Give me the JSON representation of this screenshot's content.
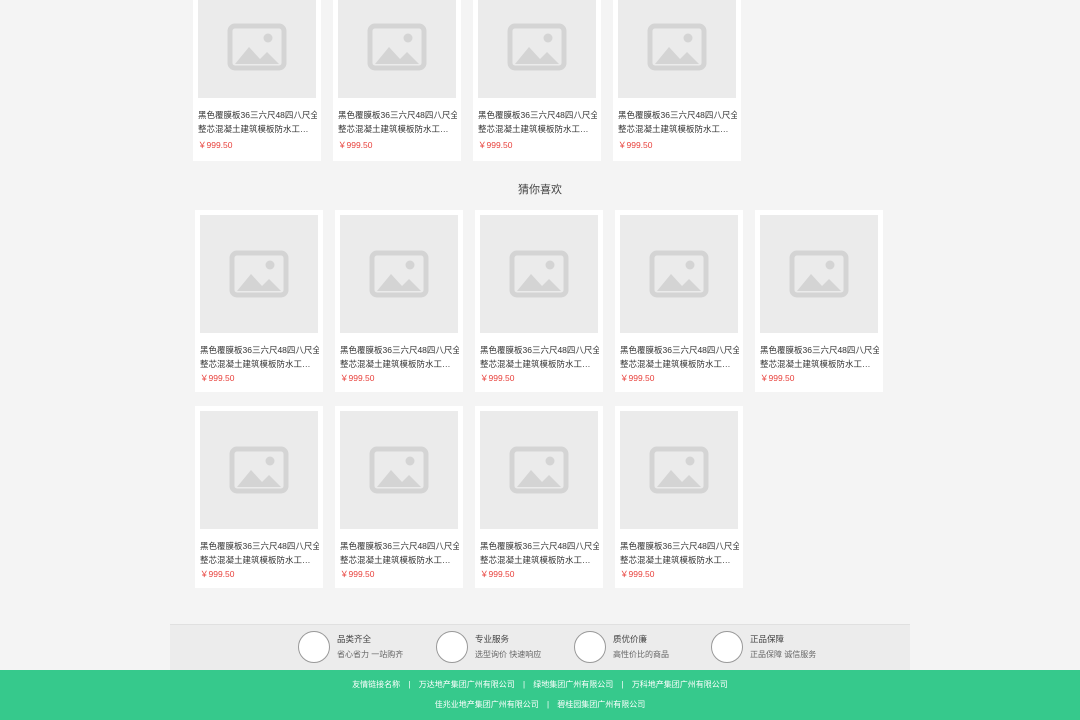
{
  "recommend_section_title": "猜你喜欢",
  "product": {
    "title_line1": "黑色覆膜板36三六尺48四八尺全",
    "title_line2": "整芯混凝土建筑模板防水工程板材",
    "price": "￥999.50"
  },
  "services": [
    {
      "title": "品类齐全",
      "subtitle": "省心省力 一站购齐"
    },
    {
      "title": "专业服务",
      "subtitle": "选型询价 快速响应"
    },
    {
      "title": "质优价廉",
      "subtitle": "高性价比的商品"
    },
    {
      "title": "正品保障",
      "subtitle": "正品保障 诚信服务"
    }
  ],
  "footer": {
    "links_label": "友情链接名称",
    "row1_links": [
      "万达地产集团广州有限公司",
      "绿地集团广州有限公司",
      "万科地产集团广州有限公司"
    ],
    "row2_links": [
      "佳兆业地产集团广州有限公司",
      "碧桂园集团广州有限公司"
    ],
    "separator": "|"
  },
  "colors": {
    "accent": "#36c98c",
    "price": "#e8413c"
  }
}
